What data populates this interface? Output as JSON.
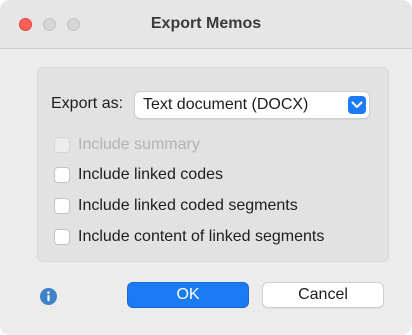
{
  "window": {
    "title": "Export Memos"
  },
  "form": {
    "export_label": "Export as:",
    "export_select": {
      "value": "Text document (DOCX)"
    },
    "options": [
      {
        "label": "Include summary",
        "checked": false,
        "disabled": true
      },
      {
        "label": "Include linked codes",
        "checked": false,
        "disabled": false
      },
      {
        "label": "Include linked coded segments",
        "checked": false,
        "disabled": false
      },
      {
        "label": "Include content of linked segments",
        "checked": false,
        "disabled": false
      }
    ]
  },
  "footer": {
    "ok_label": "OK",
    "cancel_label": "Cancel",
    "info_icon": "info-icon"
  },
  "colors": {
    "accent": "#1a7bf4",
    "close_button": "#fe5f57",
    "window_bg": "#ececec",
    "panel_bg": "#e2e2e2",
    "info_icon": "#3e82c8"
  }
}
